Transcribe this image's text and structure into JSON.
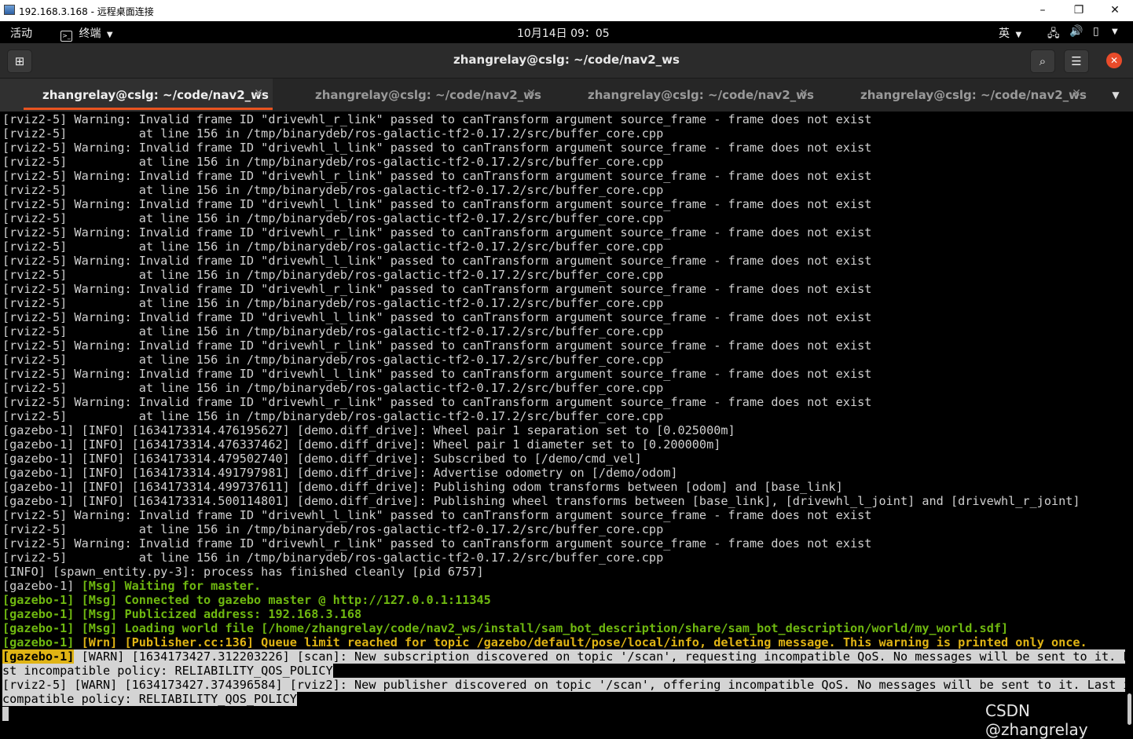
{
  "window": {
    "rdp_title": "192.168.3.168 - 远程桌面连接",
    "controls": [
      "–",
      "❐",
      "✕"
    ]
  },
  "panel": {
    "activities": "活动",
    "app_menu": "终端",
    "clock": "10月14日  09：05",
    "input_method": "英"
  },
  "header": {
    "title": "zhangrelay@cslg: ~/code/nav2_ws"
  },
  "tabs": [
    {
      "label": "zhangrelay@cslg: ~/code/nav2_ws",
      "active": true
    },
    {
      "label": "zhangrelay@cslg: ~/code/nav2_ws",
      "active": false
    },
    {
      "label": "zhangrelay@cslg: ~/code/nav2_ws",
      "active": false
    },
    {
      "label": "zhangrelay@cslg: ~/code/nav2_ws",
      "active": false
    }
  ],
  "terminal": {
    "lines": [
      "[rviz2-5] Warning: Invalid frame ID \"drivewhl_r_link\" passed to canTransform argument source_frame - frame does not exist",
      "[rviz2-5]          at line 156 in /tmp/binarydeb/ros-galactic-tf2-0.17.2/src/buffer_core.cpp",
      "[rviz2-5] Warning: Invalid frame ID \"drivewhl_l_link\" passed to canTransform argument source_frame - frame does not exist",
      "[rviz2-5]          at line 156 in /tmp/binarydeb/ros-galactic-tf2-0.17.2/src/buffer_core.cpp",
      "[rviz2-5] Warning: Invalid frame ID \"drivewhl_r_link\" passed to canTransform argument source_frame - frame does not exist",
      "[rviz2-5]          at line 156 in /tmp/binarydeb/ros-galactic-tf2-0.17.2/src/buffer_core.cpp",
      "[rviz2-5] Warning: Invalid frame ID \"drivewhl_l_link\" passed to canTransform argument source_frame - frame does not exist",
      "[rviz2-5]          at line 156 in /tmp/binarydeb/ros-galactic-tf2-0.17.2/src/buffer_core.cpp",
      "[rviz2-5] Warning: Invalid frame ID \"drivewhl_r_link\" passed to canTransform argument source_frame - frame does not exist",
      "[rviz2-5]          at line 156 in /tmp/binarydeb/ros-galactic-tf2-0.17.2/src/buffer_core.cpp",
      "[rviz2-5] Warning: Invalid frame ID \"drivewhl_l_link\" passed to canTransform argument source_frame - frame does not exist",
      "[rviz2-5]          at line 156 in /tmp/binarydeb/ros-galactic-tf2-0.17.2/src/buffer_core.cpp",
      "[rviz2-5] Warning: Invalid frame ID \"drivewhl_r_link\" passed to canTransform argument source_frame - frame does not exist",
      "[rviz2-5]          at line 156 in /tmp/binarydeb/ros-galactic-tf2-0.17.2/src/buffer_core.cpp",
      "[rviz2-5] Warning: Invalid frame ID \"drivewhl_l_link\" passed to canTransform argument source_frame - frame does not exist",
      "[rviz2-5]          at line 156 in /tmp/binarydeb/ros-galactic-tf2-0.17.2/src/buffer_core.cpp",
      "[rviz2-5] Warning: Invalid frame ID \"drivewhl_r_link\" passed to canTransform argument source_frame - frame does not exist",
      "[rviz2-5]          at line 156 in /tmp/binarydeb/ros-galactic-tf2-0.17.2/src/buffer_core.cpp",
      "[rviz2-5] Warning: Invalid frame ID \"drivewhl_l_link\" passed to canTransform argument source_frame - frame does not exist",
      "[rviz2-5]          at line 156 in /tmp/binarydeb/ros-galactic-tf2-0.17.2/src/buffer_core.cpp",
      "[rviz2-5] Warning: Invalid frame ID \"drivewhl_r_link\" passed to canTransform argument source_frame - frame does not exist",
      "[rviz2-5]          at line 156 in /tmp/binarydeb/ros-galactic-tf2-0.17.2/src/buffer_core.cpp",
      "[gazebo-1] [INFO] [1634173314.476195627] [demo.diff_drive]: Wheel pair 1 separation set to [0.025000m]",
      "[gazebo-1] [INFO] [1634173314.476337462] [demo.diff_drive]: Wheel pair 1 diameter set to [0.200000m]",
      "[gazebo-1] [INFO] [1634173314.479502740] [demo.diff_drive]: Subscribed to [/demo/cmd_vel]",
      "[gazebo-1] [INFO] [1634173314.491797981] [demo.diff_drive]: Advertise odometry on [/demo/odom]",
      "[gazebo-1] [INFO] [1634173314.499737611] [demo.diff_drive]: Publishing odom transforms between [odom] and [base_link]",
      "[gazebo-1] [INFO] [1634173314.500114801] [demo.diff_drive]: Publishing wheel transforms between [base_link], [drivewhl_l_joint] and [drivewhl_r_joint]",
      "[rviz2-5] Warning: Invalid frame ID \"drivewhl_l_link\" passed to canTransform argument source_frame - frame does not exist",
      "[rviz2-5]          at line 156 in /tmp/binarydeb/ros-galactic-tf2-0.17.2/src/buffer_core.cpp",
      "[rviz2-5] Warning: Invalid frame ID \"drivewhl_r_link\" passed to canTransform argument source_frame - frame does not exist",
      "[rviz2-5]          at line 156 in /tmp/binarydeb/ros-galactic-tf2-0.17.2/src/buffer_core.cpp",
      "[INFO] [spawn_entity.py-3]: process has finished cleanly [pid 6757]"
    ],
    "msg_prefix": "[gazebo-1] ",
    "msg_lines": [
      "[Msg] Waiting for master.",
      "[Msg] Connected to gazebo master @ http://127.0.0.1:11345",
      "[Msg] Publicized address: 192.168.3.168",
      "[Msg] Loading world file [/home/zhangrelay/code/nav2_ws/install/sam_bot_description/share/sam_bot_description/world/my_world.sdf]"
    ],
    "wrn_line": "[Wrn] [Publisher.cc:136] Queue limit reached for topic /gazebo/default/pose/local/info, deleting message. This warning is printed only once.",
    "sel_tag": "[gazebo-1]",
    "sel_lines": [
      " [WARN] [1634173427.312203226] [scan]: New subscription discovered on topic '/scan', requesting incompatible QoS. No messages will be sent to it. La",
      "st incompatible policy: RELIABILITY_QOS_POLICY",
      "[rviz2-5] [WARN] [1634173427.374396584] [rviz2]: New publisher discovered on topic '/scan', offering incompatible QoS. No messages will be sent to it. Last in",
      "compatible policy: RELIABILITY_QOS_POLICY"
    ]
  },
  "watermark": "CSDN @zhangrelay",
  "colors": {
    "accent": "#e95420",
    "msg_green": "#6fb810",
    "warn_yellow": "#e0b414",
    "close_red": "#e94b2a"
  }
}
